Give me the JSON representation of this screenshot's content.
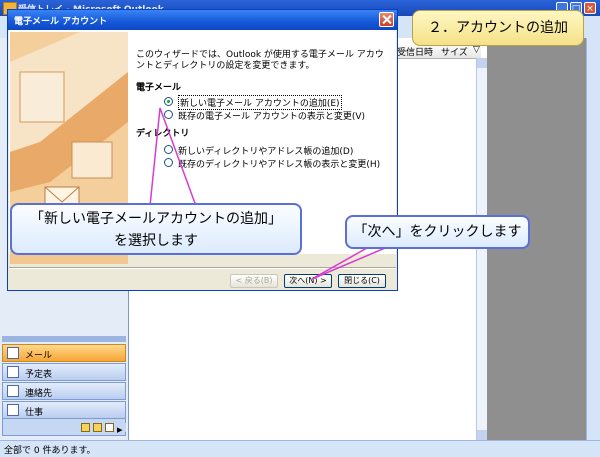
{
  "outlook": {
    "title": "受信トレイ - Microsoft Outlook",
    "column_headers": [
      "受信日時",
      "サイズ"
    ],
    "nav_buttons": [
      {
        "label": "メール",
        "active": true
      },
      {
        "label": "予定表",
        "active": false
      },
      {
        "label": "連絡先",
        "active": false
      },
      {
        "label": "仕事",
        "active": false
      }
    ],
    "status": "全部で 0 件あります。"
  },
  "dialog": {
    "title": "電子メール アカウント",
    "intro": "このウィザードでは、Outlook が使用する電子メール アカウントとディレクトリの設定を変更できます。",
    "email_section": "電子メール",
    "email_options": [
      {
        "label": "新しい電子メール アカウントの追加(E)",
        "checked": true
      },
      {
        "label": "既存の電子メール アカウントの表示と変更(V)",
        "checked": false
      }
    ],
    "directory_section": "ディレクトリ",
    "directory_options": [
      {
        "label": "新しいディレクトリやアドレス帳の追加(D)",
        "checked": false
      },
      {
        "label": "既存のディレクトリやアドレス帳の表示と変更(H)",
        "checked": false
      }
    ],
    "buttons": {
      "back": "< 戻る(B)",
      "next": "次へ(N) >",
      "close": "閉じる(C)"
    }
  },
  "annotations": {
    "step_badge": "２．アカウントの追加",
    "callout_select_line1": "「新しい電子メールアカウントの追加」",
    "callout_select_line2": "を選択します",
    "callout_next": "「次へ」をクリックします"
  },
  "colors": {
    "callout_border": "#5b6fd6",
    "arrow": "#d63cd0",
    "title_blue": "#1458d8",
    "badge_fill": "#f4e188"
  }
}
